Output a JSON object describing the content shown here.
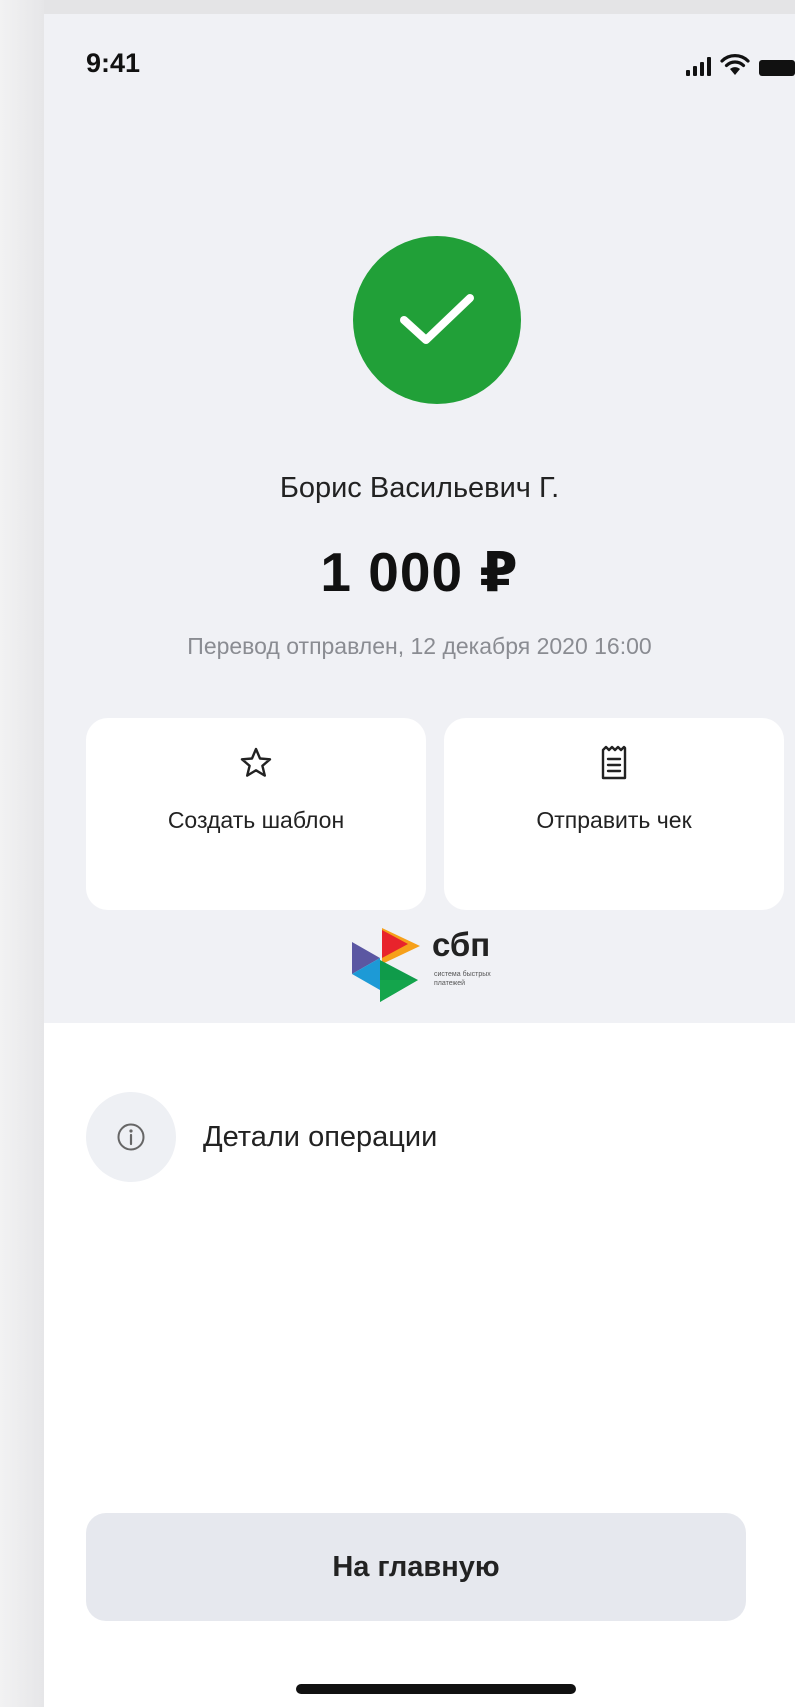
{
  "status_bar": {
    "time": "9:41"
  },
  "success": {
    "icon": "checkmark-icon",
    "color": "#21a038"
  },
  "transfer": {
    "recipient": "Борис Васильевич Г.",
    "amount": "1 000 ₽",
    "status": "Перевод отправлен, 12 декабря 2020 16:00"
  },
  "actions": [
    {
      "icon": "star-icon",
      "label": "Создать шаблон"
    },
    {
      "icon": "receipt-icon",
      "label": "Отправить чек"
    }
  ],
  "sbp": {
    "logo_text": "сбп",
    "subtitle": "система быстрых платежей"
  },
  "details": {
    "icon": "info-icon",
    "label": "Детали операции"
  },
  "home_button": {
    "label": "На главную"
  },
  "colors": {
    "accent_green": "#21a038",
    "background_top": "#f0f1f5",
    "button_bg": "#e6e8ee"
  }
}
